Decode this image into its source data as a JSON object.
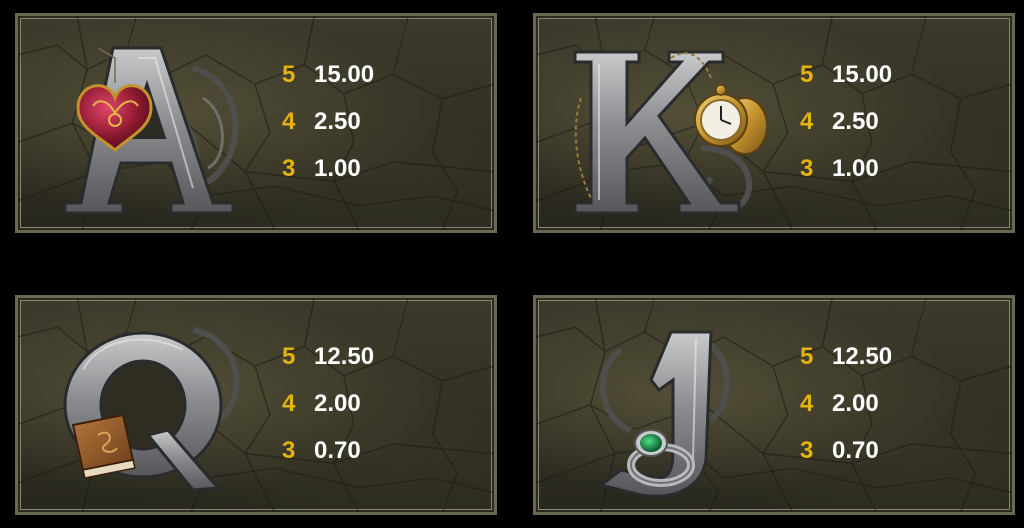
{
  "colors": {
    "count": "#e3b30f",
    "value": "#ffffff",
    "panel_bg": "#35332a",
    "frame": "#6b6850",
    "letter_stone": "#8e8f91"
  },
  "panels": [
    {
      "symbol": "A",
      "icon": "heart-locket-icon",
      "paytable": [
        {
          "count": "5",
          "value": "15.00"
        },
        {
          "count": "4",
          "value": "2.50"
        },
        {
          "count": "3",
          "value": "1.00"
        }
      ]
    },
    {
      "symbol": "K",
      "icon": "pocket-watch-icon",
      "paytable": [
        {
          "count": "5",
          "value": "15.00"
        },
        {
          "count": "4",
          "value": "2.50"
        },
        {
          "count": "3",
          "value": "1.00"
        }
      ]
    },
    {
      "symbol": "Q",
      "icon": "book-icon",
      "paytable": [
        {
          "count": "5",
          "value": "12.50"
        },
        {
          "count": "4",
          "value": "2.00"
        },
        {
          "count": "3",
          "value": "0.70"
        }
      ]
    },
    {
      "symbol": "J",
      "icon": "emerald-ring-icon",
      "paytable": [
        {
          "count": "5",
          "value": "12.50"
        },
        {
          "count": "4",
          "value": "2.00"
        },
        {
          "count": "3",
          "value": "0.70"
        }
      ]
    }
  ]
}
